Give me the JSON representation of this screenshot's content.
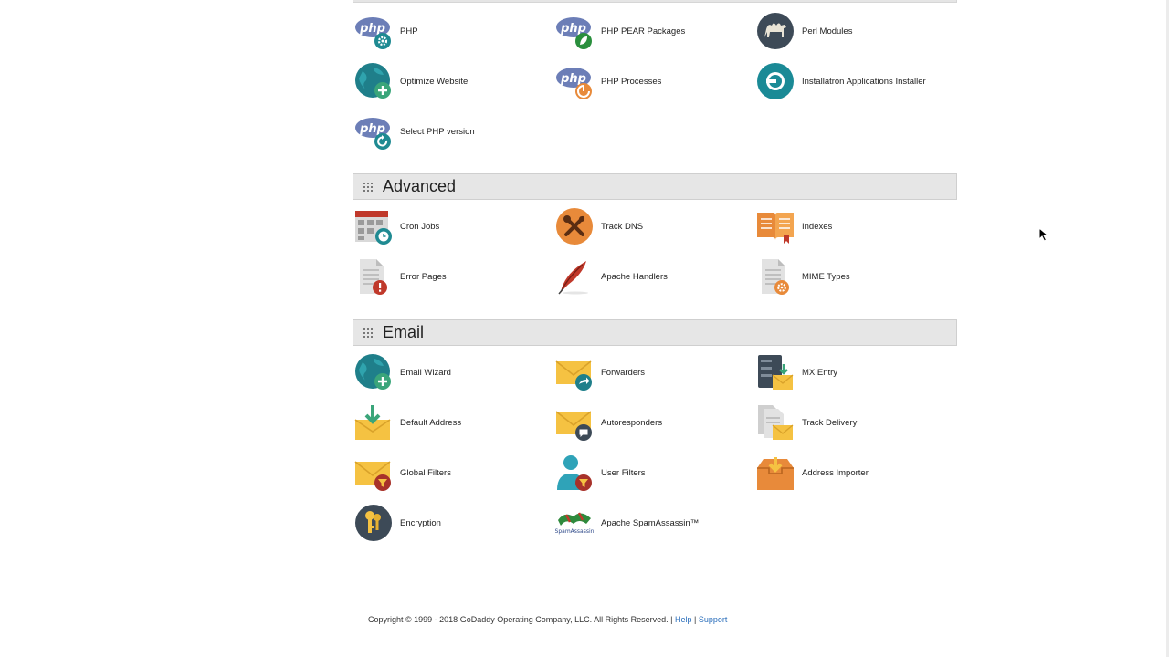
{
  "software": {
    "items": [
      {
        "label": "PHP",
        "icon": "php-gear-icon"
      },
      {
        "label": "PHP PEAR Packages",
        "icon": "php-leaf-icon"
      },
      {
        "label": "Perl Modules",
        "icon": "camel-icon"
      },
      {
        "label": "Optimize Website",
        "icon": "globe-plus-icon"
      },
      {
        "label": "PHP Processes",
        "icon": "php-process-icon"
      },
      {
        "label": "Installatron Applications Installer",
        "icon": "installatron-icon"
      },
      {
        "label": "Select PHP version",
        "icon": "php-refresh-icon"
      }
    ]
  },
  "advanced": {
    "title": "Advanced",
    "items": [
      {
        "label": "Cron Jobs",
        "icon": "calendar-clock-icon"
      },
      {
        "label": "Track DNS",
        "icon": "tools-icon"
      },
      {
        "label": "Indexes",
        "icon": "book-icon"
      },
      {
        "label": "Error Pages",
        "icon": "document-error-icon"
      },
      {
        "label": "Apache Handlers",
        "icon": "feather-icon"
      },
      {
        "label": "MIME Types",
        "icon": "document-gear-icon"
      }
    ]
  },
  "email": {
    "title": "Email",
    "items": [
      {
        "label": "Email Wizard",
        "icon": "globe-plus-icon"
      },
      {
        "label": "Forwarders",
        "icon": "envelope-arrow-icon"
      },
      {
        "label": "MX Entry",
        "icon": "server-envelope-icon"
      },
      {
        "label": "Default Address",
        "icon": "envelope-download-icon"
      },
      {
        "label": "Autoresponders",
        "icon": "envelope-chat-icon"
      },
      {
        "label": "Track Delivery",
        "icon": "documents-envelope-icon"
      },
      {
        "label": "Global Filters",
        "icon": "envelope-filter-icon"
      },
      {
        "label": "User Filters",
        "icon": "user-filter-icon"
      },
      {
        "label": "Address Importer",
        "icon": "box-import-icon"
      },
      {
        "label": "Encryption",
        "icon": "keys-icon"
      },
      {
        "label": "Apache SpamAssassin™",
        "icon": "spamassassin-logo-icon"
      }
    ]
  },
  "footer": {
    "copyright": "Copyright © 1999 - 2018 GoDaddy Operating Company, LLC. All Rights Reserved.",
    "separator": "|",
    "help": "Help",
    "support": "Support"
  },
  "colors": {
    "teal": "#1f7f8a",
    "php_blue": "#6c7eb7",
    "orange": "#e88a3a",
    "envelope_yellow": "#f5c242",
    "dark_slate": "#3d4a57",
    "red": "#c0392b",
    "link": "#2a6ebb"
  }
}
